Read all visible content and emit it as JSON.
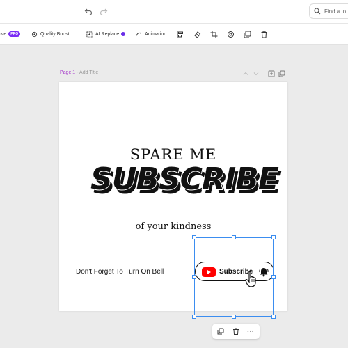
{
  "toolbar": {
    "remove_bg_label": "ove",
    "remove_bg_badge": "PRO",
    "quality_boost_label": "Quality Boost",
    "ai_replace_label": "AI Replace",
    "animation_label": "Animation"
  },
  "search": {
    "placeholder": "Find a to"
  },
  "page_header": {
    "page_number": "Page 1",
    "separator": " - ",
    "title_placeholder": "Add Title"
  },
  "design": {
    "headline": "SPARE ME",
    "big_word": "SUBSCRIBE",
    "tagline": "of your kindness",
    "bell_reminder": "Don't Forget To Turn On Bell",
    "subscribe_button_label": "Subscribe"
  },
  "context_menu": {
    "more_label": "···"
  },
  "colors": {
    "accent_purple": "#7b2cf5",
    "selection_blue": "#3b8df0",
    "youtube_red": "#ff0000"
  }
}
